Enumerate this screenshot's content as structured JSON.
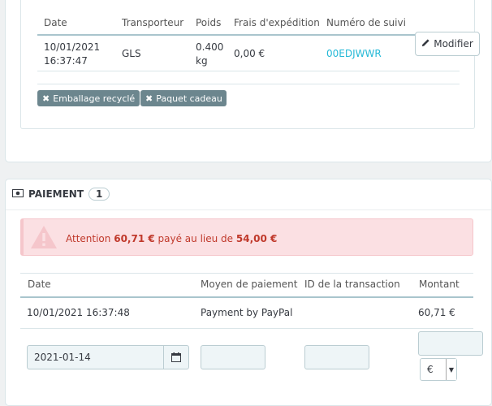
{
  "shipping": {
    "headers": [
      "Date",
      "Transporteur",
      "Poids",
      "Frais d'expédition",
      "Numéro de suivi"
    ],
    "row": {
      "date": "10/01/2021",
      "time": "16:37:47",
      "carrier": "GLS",
      "weight_value": "0.400",
      "weight_unit": "kg",
      "fee": "0,00 €",
      "tracking": "00EDJWWR",
      "edit_label": "Modifier"
    },
    "tags": [
      "Emballage recyclé",
      "Paquet cadeau"
    ]
  },
  "payment": {
    "title": "PAIEMENT",
    "count": "1",
    "alert": {
      "prefix": "Attention",
      "paid": "60,71 €",
      "middle": "payé au lieu de",
      "expected": "54,00 €"
    },
    "headers": [
      "Date",
      "Moyen de paiement",
      "ID de la transaction",
      "Montant"
    ],
    "row": {
      "date": "10/01/2021 16:37:48",
      "method": "Payment by PayPal",
      "transaction_id": "",
      "amount": "60,71 €"
    },
    "form": {
      "date_value": "2021-01-14",
      "method_value": "",
      "transaction_value": "",
      "amount_value": "",
      "currency": "€"
    }
  },
  "colors": {
    "link": "#25b9d7",
    "alert_bg": "#fbe0e3",
    "alert_text": "#c0392b",
    "tag_bg": "#6c868e"
  }
}
